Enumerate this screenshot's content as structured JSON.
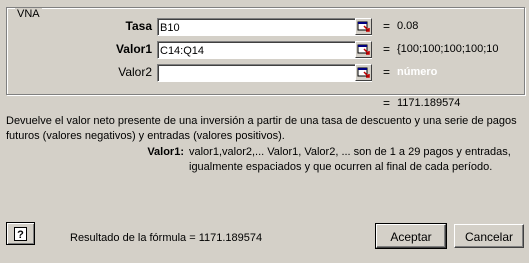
{
  "dialog": {
    "group_title": "VNA",
    "args": [
      {
        "label": "Tasa",
        "value": "B10",
        "result": "0.08"
      },
      {
        "label": "Valor1",
        "value": "C14:Q14",
        "result": "{100;100;100;100;10"
      },
      {
        "label": "Valor2",
        "value": "",
        "result": "número"
      }
    ],
    "equals_sign": "=",
    "formula_value": "1171.189574",
    "description": "Devuelve el valor neto presente de una inversión a partir de una tasa de descuento y una serie de pagos futuros (valores negativos) y entradas (valores positivos).",
    "arg_desc_name": "Valor1:",
    "arg_desc_text": "valor1,valor2,... Valor1, Valor2, ... son de 1 a 29 pagos y entradas, igualmente espaciados y que ocurren al final de cada período.",
    "formula_result": "Resultado de la fórmula = 1171.189574",
    "ok_label": "Aceptar",
    "cancel_label": "Cancelar",
    "ref_icon": "collapse-dialog-icon",
    "help_icon": "help-icon"
  }
}
